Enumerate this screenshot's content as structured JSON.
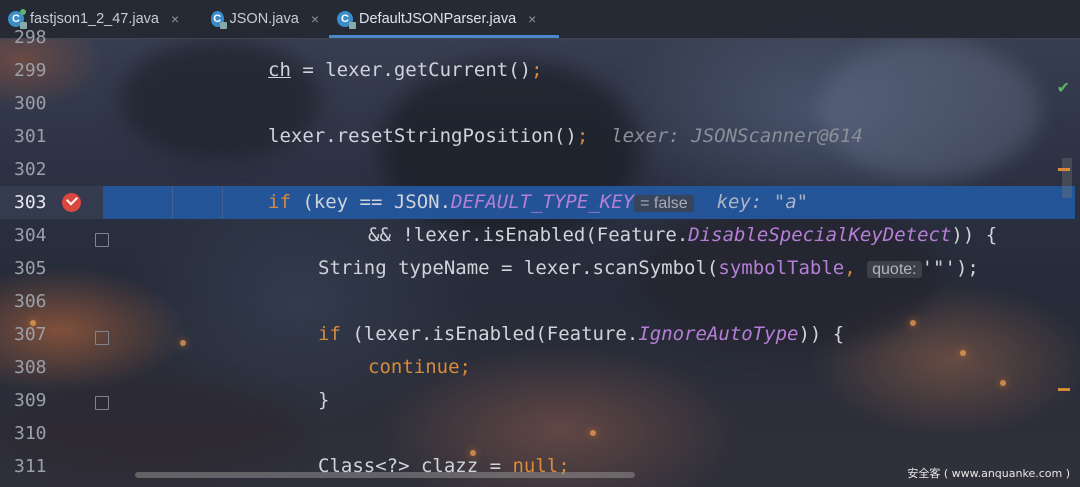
{
  "tabs": [
    {
      "label": "fastjson1_2_47.java",
      "active": false,
      "icon": "class-file-icon"
    },
    {
      "label": "JSON.java",
      "active": false,
      "icon": "class-file-icon"
    },
    {
      "label": "DefaultJSONParser.java",
      "active": true,
      "icon": "class-file-icon"
    }
  ],
  "tab_close": "×",
  "lines": [
    {
      "num": "298"
    },
    {
      "num": "299",
      "code": {
        "var": "ch",
        "rest": " = lexer.getCurrent()",
        "semi": ";"
      }
    },
    {
      "num": "300"
    },
    {
      "num": "301",
      "code": {
        "text": "lexer.resetStringPosition()",
        "semi": ";",
        "hint": "lexer: JSONScanner@614"
      }
    },
    {
      "num": "302"
    },
    {
      "num": "303",
      "code": {
        "kw": "if",
        "a": " (key == JSON.",
        "const": "DEFAULT_TYPE_KEY",
        "inlay": "= false",
        "hint": "key: \"a\""
      }
    },
    {
      "num": "304",
      "code": {
        "a": "&& !lexer.isEnabled(Feature.",
        "const": "DisableSpecialKeyDetect",
        "b": ")) {"
      }
    },
    {
      "num": "305",
      "code": {
        "a": "String typeName = lexer.scanSymbol(",
        "fld": "symbolTable",
        "b": ",",
        "inlay": "quote:",
        "c": "'\"'",
        "semi": ");"
      }
    },
    {
      "num": "306"
    },
    {
      "num": "307",
      "code": {
        "kw": "if",
        "a": " (lexer.isEnabled(Feature.",
        "const": "IgnoreAutoType",
        "b": ")) {"
      }
    },
    {
      "num": "308",
      "code": {
        "kw": "continue",
        "semi": ";"
      }
    },
    {
      "num": "309",
      "code": {
        "a": "}"
      }
    },
    {
      "num": "310"
    },
    {
      "num": "311",
      "code": {
        "a": "Class<?> clazz = ",
        "kw": "null",
        "semi": ";"
      }
    }
  ],
  "status": {
    "check": "✔"
  },
  "watermark": "安全客 ( www.anquanke.com )",
  "colors": {
    "keyword": "#d98a3a",
    "constant": "#b57fd6",
    "highlight": "#2458a0",
    "accent": "#4a88c7"
  }
}
